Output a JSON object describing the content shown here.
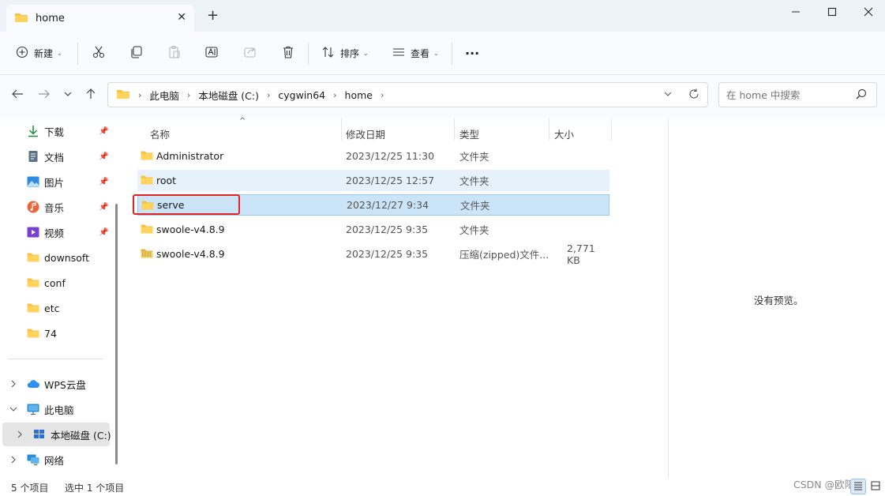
{
  "window": {
    "tab_title": "home",
    "new_tab_glyph": "+",
    "close_tab_glyph": "✕",
    "minimize_glyph": "—",
    "maximize_glyph": "☐",
    "close_glyph": "✕"
  },
  "toolbar": {
    "new_label": "新建",
    "sort_label": "排序",
    "view_label": "查看",
    "more_glyph": "···",
    "icons": [
      "cut-icon",
      "copy-icon",
      "paste-icon",
      "rename-icon",
      "share-icon",
      "delete-icon"
    ]
  },
  "address": {
    "breadcrumbs": [
      "此电脑",
      "本地磁盘 (C:)",
      "cygwin64",
      "home"
    ]
  },
  "search": {
    "placeholder": "在 home 中搜索"
  },
  "sidebar": {
    "quick_access": [
      {
        "label": "下载",
        "icon": "download-icon",
        "pinned": true
      },
      {
        "label": "文档",
        "icon": "documents-icon",
        "pinned": true
      },
      {
        "label": "图片",
        "icon": "pictures-icon",
        "pinned": true
      },
      {
        "label": "音乐",
        "icon": "music-icon",
        "pinned": true
      },
      {
        "label": "视频",
        "icon": "video-icon",
        "pinned": true
      },
      {
        "label": "downsoft",
        "icon": "folder-icon",
        "pinned": false
      },
      {
        "label": "conf",
        "icon": "folder-icon",
        "pinned": false
      },
      {
        "label": "etc",
        "icon": "folder-icon",
        "pinned": false
      },
      {
        "label": "74",
        "icon": "folder-icon",
        "pinned": false
      }
    ],
    "tree": [
      {
        "label": "WPS云盘",
        "icon": "cloud-icon",
        "expanded": false
      },
      {
        "label": "此电脑",
        "icon": "computer-icon",
        "expanded": true
      },
      {
        "label": "本地磁盘 (C:)",
        "icon": "drive-icon",
        "expanded": false,
        "selected": true
      },
      {
        "label": "网络",
        "icon": "network-icon",
        "expanded": false
      }
    ]
  },
  "filelist": {
    "columns": {
      "name": "名称",
      "date": "修改日期",
      "type": "类型",
      "size": "大小"
    },
    "rows": [
      {
        "name": "Administrator",
        "date": "2023/12/25 11:30",
        "type": "文件夹",
        "size": "",
        "icon": "folder-icon"
      },
      {
        "name": "root",
        "date": "2023/12/25 12:57",
        "type": "文件夹",
        "size": "",
        "icon": "folder-icon"
      },
      {
        "name": "serve",
        "date": "2023/12/27 9:34",
        "type": "文件夹",
        "size": "",
        "icon": "folder-icon"
      },
      {
        "name": "swoole-v4.8.9",
        "date": "2023/12/25 9:35",
        "type": "文件夹",
        "size": "",
        "icon": "folder-icon"
      },
      {
        "name": "swoole-v4.8.9",
        "date": "2023/12/25 9:35",
        "type": "压缩(zipped)文件...",
        "size": "2,771 KB",
        "icon": "zip-folder-icon"
      }
    ]
  },
  "preview": {
    "text": "没有预览。"
  },
  "status": {
    "item_count": "5 个项目",
    "selected": "选中 1 个项目"
  },
  "watermark": "CSDN @欧阳码"
}
